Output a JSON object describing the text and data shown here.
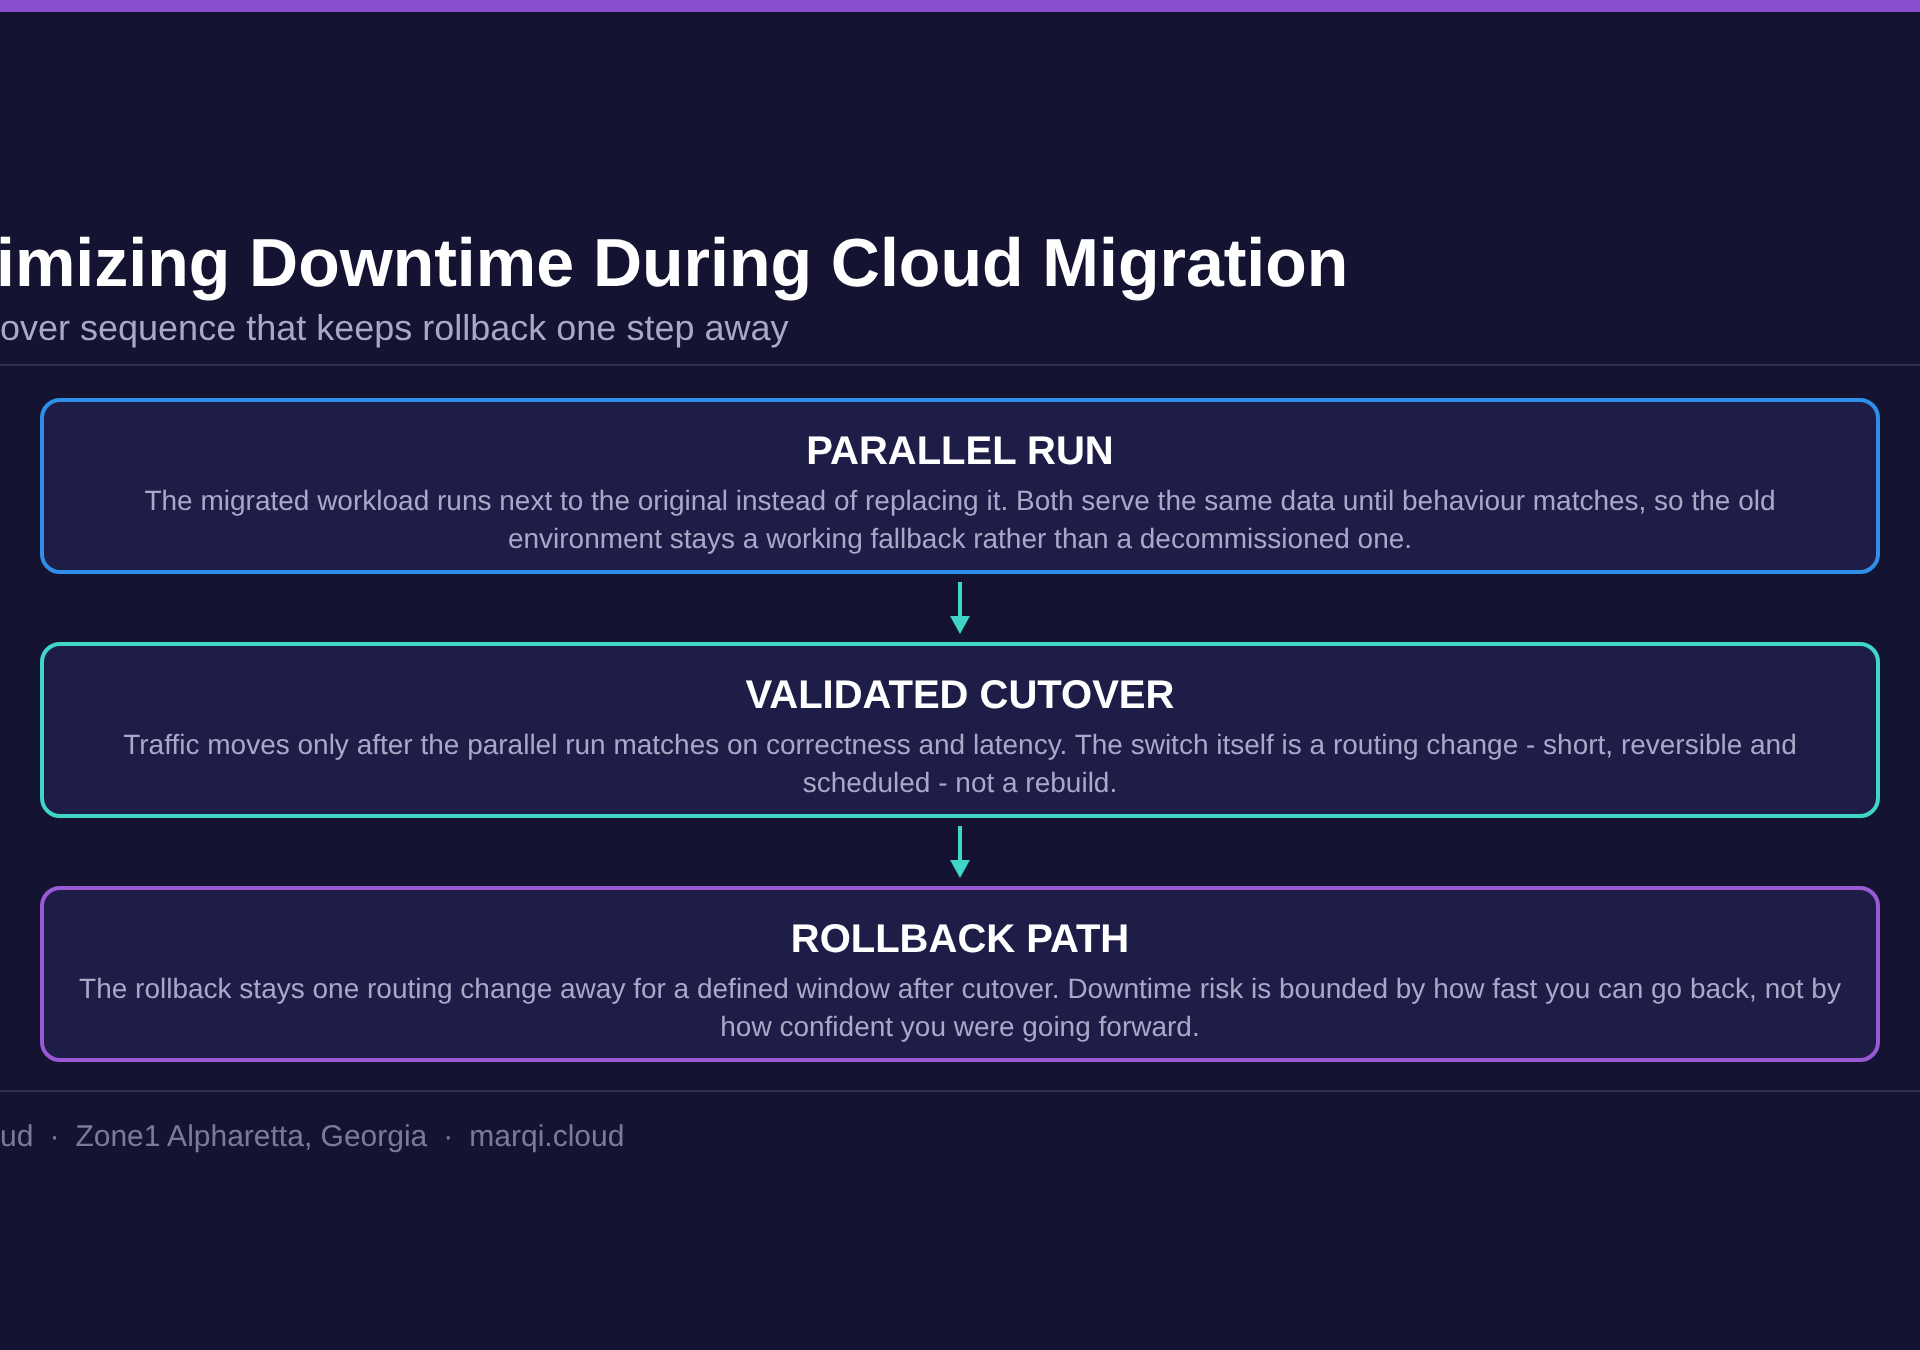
{
  "header": {
    "title": "imizing Downtime During Cloud Migration",
    "subtitle": "over sequence that keeps rollback one step away"
  },
  "steps": [
    {
      "title": "PARALLEL RUN",
      "text": "The migrated workload runs next to the original instead of replacing it. Both serve the same data until behaviour matches, so the old environment stays a working fallback rather than a decommissioned one.",
      "color": "#2f8fe8"
    },
    {
      "title": "VALIDATED CUTOVER",
      "text": "Traffic moves only after the parallel run matches on correctness and latency. The switch itself is a routing change - short, reversible and scheduled - not a rebuild.",
      "color": "#3fd6c8"
    },
    {
      "title": "ROLLBACK PATH",
      "text": "The rollback stays one routing change away for a defined window after cutover. Downtime risk is bounded by how fast you can go back, not by how confident you were going forward.",
      "color": "#9a5ad6"
    }
  ],
  "footer": {
    "items": [
      "ud",
      "Zone1 Alpharetta, Georgia",
      "marqi.cloud"
    ],
    "separator": "·"
  }
}
